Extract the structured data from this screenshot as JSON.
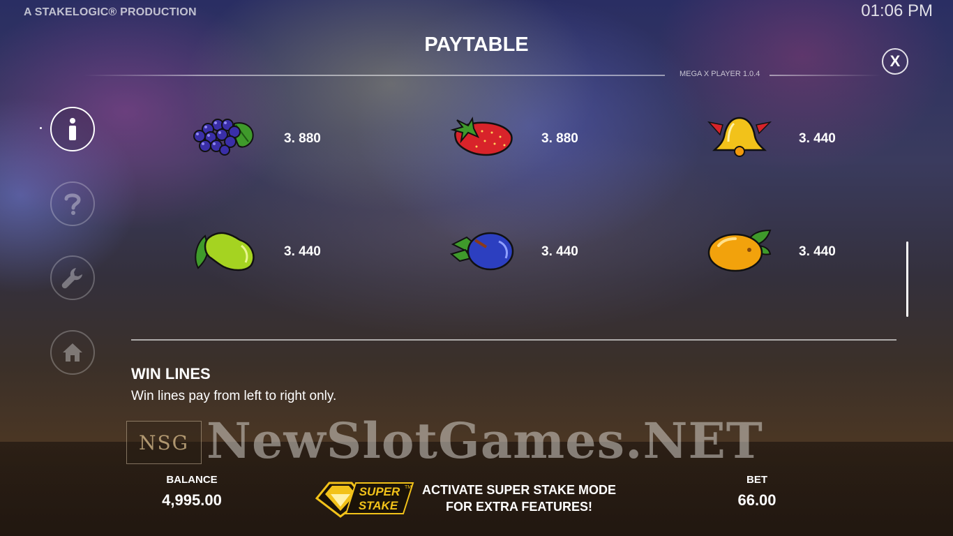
{
  "header": {
    "production": "A STAKELOGIC® PRODUCTION",
    "clock": "01:06 PM",
    "title": "PAYTABLE",
    "version": "MEGA X PLAYER 1.0.4",
    "close_label": "X"
  },
  "sidebar": {
    "items": [
      {
        "name": "info",
        "icon": "info-icon"
      },
      {
        "name": "help",
        "icon": "question-icon"
      },
      {
        "name": "settings",
        "icon": "wrench-icon"
      },
      {
        "name": "home",
        "icon": "home-icon"
      }
    ]
  },
  "paytable": {
    "items": [
      {
        "symbol": "grapes-icon",
        "value": "3. 880"
      },
      {
        "symbol": "strawberry-icon",
        "value": "3. 880"
      },
      {
        "symbol": "bell-icon",
        "value": "3. 440"
      },
      {
        "symbol": "pear-icon",
        "value": "3. 440"
      },
      {
        "symbol": "plum-icon",
        "value": "3. 440"
      },
      {
        "symbol": "orange-icon",
        "value": "3. 440"
      }
    ]
  },
  "win_lines": {
    "title": "WIN LINES",
    "text": "Win lines pay from left to right only."
  },
  "watermark": {
    "logo": "NSG",
    "text": "NewSlotGames.NET"
  },
  "footer": {
    "balance_label": "BALANCE",
    "balance_value": "4,995.00",
    "super_stake_logo": "SUPER STAKE",
    "super_stake_tm": "TM",
    "promo_line1": "ACTIVATE SUPER STAKE MODE",
    "promo_line2": "FOR EXTRA FEATURES!",
    "bet_label": "BET",
    "bet_value": "66.00"
  },
  "colors": {
    "accent_gold": "#f2c21a",
    "grape": "#3a2fa8",
    "strawberry": "#d8232a",
    "pear": "#a5d321",
    "plum": "#2c3fc0",
    "orange": "#f2a20c"
  }
}
